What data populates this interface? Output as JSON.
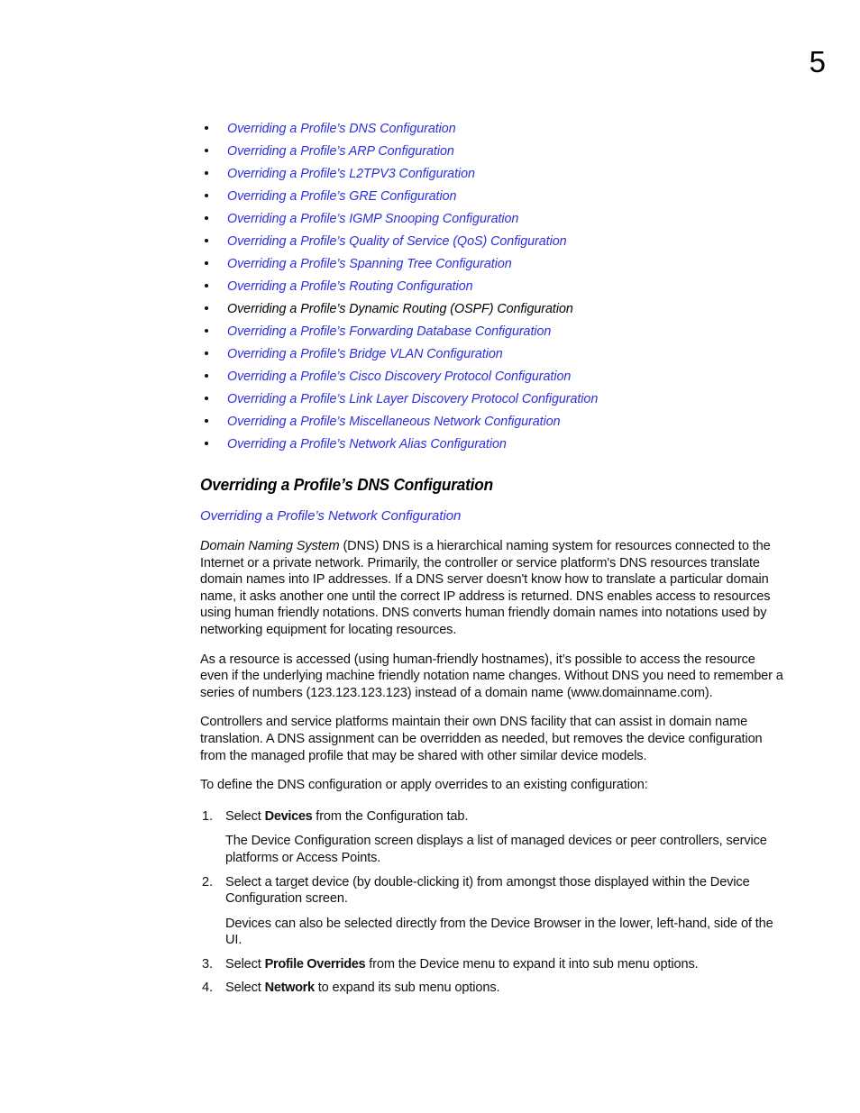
{
  "page": {
    "number": "5"
  },
  "xref_list": [
    {
      "label": "Overriding a Profile’s DNS Configuration",
      "is_link": true
    },
    {
      "label": "Overriding a Profile’s ARP Configuration",
      "is_link": true
    },
    {
      "label": "Overriding a Profile’s L2TPV3 Configuration",
      "is_link": true
    },
    {
      "label": "Overriding a Profile’s GRE Configuration",
      "is_link": true
    },
    {
      "label": "Overriding a Profile’s IGMP Snooping Configuration",
      "is_link": true
    },
    {
      "label": "Overriding a Profile’s Quality of Service (QoS) Configuration",
      "is_link": true
    },
    {
      "label": "Overriding a Profile’s Spanning Tree Configuration",
      "is_link": true
    },
    {
      "label": "Overriding a Profile’s Routing Configuration",
      "is_link": true
    },
    {
      "label": "Overriding a Profile’s Dynamic Routing (OSPF) Configuration",
      "is_link": false
    },
    {
      "label": "Overriding a Profile’s Forwarding Database Configuration",
      "is_link": true
    },
    {
      "label": "Overriding a Profile’s Bridge VLAN Configuration",
      "is_link": true
    },
    {
      "label": "Overriding a Profile’s Cisco Discovery Protocol Configuration",
      "is_link": true
    },
    {
      "label": "Overriding a Profile’s Link Layer Discovery Protocol Configuration",
      "is_link": true
    },
    {
      "label": "Overriding a Profile’s Miscellaneous Network Configuration",
      "is_link": true
    },
    {
      "label": "Overriding a Profile’s Network Alias Configuration",
      "is_link": true
    }
  ],
  "section": {
    "heading": "Overriding a Profile’s DNS Configuration",
    "parent_link": "Overriding a Profile’s Network Configuration"
  },
  "paragraphs": {
    "p1_italic_lead": "Domain Naming System",
    "p1_rest": " (DNS) DNS is a hierarchical naming system for resources connected to the Internet or a private network. Primarily, the controller or service platform's DNS resources translate domain names into IP addresses. If a DNS server doesn't know how to translate a particular domain name, it asks another one until the correct IP address is returned. DNS enables access to resources using human friendly notations. DNS converts human friendly domain names into notations used by networking equipment for locating resources.",
    "p2": "As a resource is accessed (using human-friendly hostnames), it’s possible to access the resource even if the underlying machine friendly notation name changes. Without DNS you need to remember a series of numbers (123.123.123.123) instead of a domain name (www.domainname.com).",
    "p3": "Controllers and service platforms maintain their own DNS facility that can assist in domain name translation. A DNS assignment can be overridden as needed, but removes the device configuration from the managed profile that may be shared with other similar device models.",
    "p4": "To define the DNS configuration or apply overrides to an existing configuration:"
  },
  "steps": [
    {
      "num": "1.",
      "pre": "Select ",
      "bold": "Devices",
      "post": " from the Configuration tab.",
      "note": "The Device Configuration screen displays a list of managed devices or peer controllers, service platforms or Access Points."
    },
    {
      "num": "2.",
      "pre": "Select a target device (by double-clicking it) from amongst those displayed within the Device Configuration screen.",
      "bold": "",
      "post": "",
      "note": "Devices can also be selected directly from the Device Browser in the lower, left-hand, side of the UI."
    },
    {
      "num": "3.",
      "pre": "Select ",
      "bold": "Profile Overrides",
      "post": " from the Device menu to expand it into sub menu options.",
      "note": ""
    },
    {
      "num": "4.",
      "pre": "Select ",
      "bold": "Network",
      "post": " to expand its sub menu options.",
      "note": ""
    }
  ],
  "colors": {
    "link": "#2d2de0",
    "text": "#111111",
    "background": "#ffffff"
  }
}
